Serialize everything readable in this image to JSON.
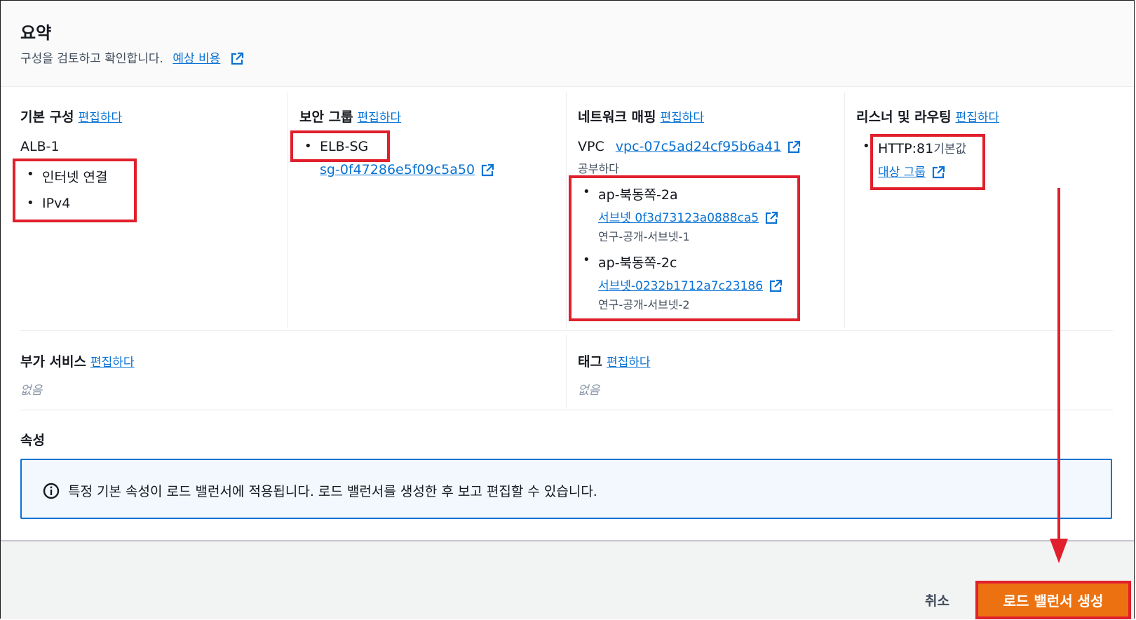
{
  "header": {
    "title": "요약",
    "subtitle": "구성을 검토하고 확인합니다.",
    "cost_link": "예상 비용"
  },
  "edit_label": "편집하다",
  "basic": {
    "title": "기본 구성",
    "name": "ALB-1",
    "items": [
      "인터넷 연결",
      "IPv4"
    ]
  },
  "security": {
    "title": "보안 그룹",
    "group_name": "ELB-SG",
    "group_id": "sg-0f47286e5f09c5a50"
  },
  "network": {
    "title": "네트워크 매핑",
    "vpc_label": "VPC",
    "vpc_id": "vpc-07c5ad24cf95b6a41",
    "vpc_name": "공부하다",
    "zones": [
      {
        "az": "ap-북동쪽-2a",
        "subnet_link": "서브넷 0f3d73123a0888ca5",
        "subnet_name": "연구-공개-서브넷-1"
      },
      {
        "az": "ap-북동쪽-2c",
        "subnet_link": "서브넷-0232b1712a7c23186",
        "subnet_name": "연구-공개-서브넷-2"
      }
    ]
  },
  "listener": {
    "title": "리스너 및 라우팅",
    "protocol": "HTTP:81",
    "default_label": "기본값",
    "target_link": "대상 그룹"
  },
  "addons": {
    "title": "부가 서비스",
    "value": "없음"
  },
  "tags": {
    "title": "태그",
    "value": "없음"
  },
  "attributes": {
    "title": "속성",
    "info": "특정 기본 속성이 로드 밸런서에 적용됩니다. 로드 밸런서를 생성한 후 보고 편집할 수 있습니다."
  },
  "footer": {
    "cancel": "취소",
    "create": "로드 밸런서 생성"
  },
  "colors": {
    "link": "#0972d3",
    "primary_button": "#ec7211",
    "annotation": "#e0202c",
    "info_border": "#0972d3"
  }
}
